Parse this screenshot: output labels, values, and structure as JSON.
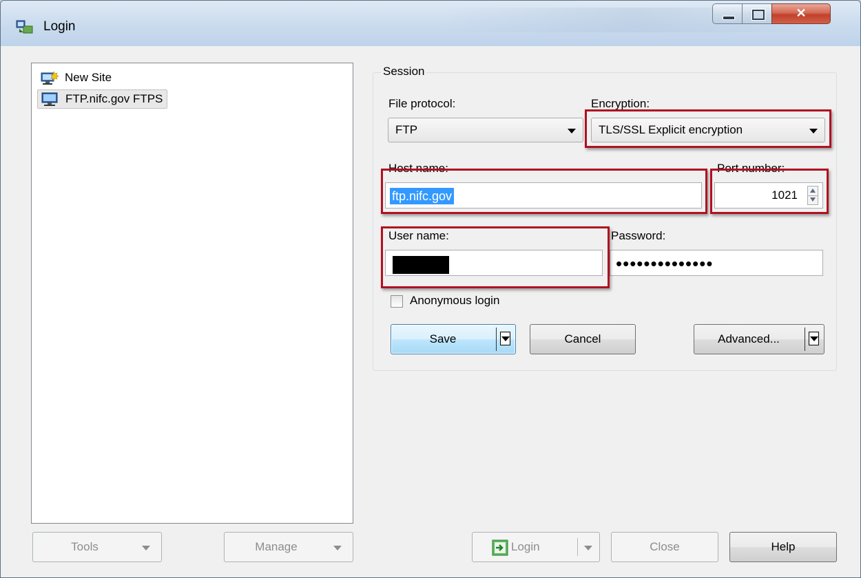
{
  "window": {
    "title": "Login"
  },
  "sites": [
    {
      "label": "New Site",
      "icon": "new-site-icon",
      "selected": false
    },
    {
      "label": "FTP.nifc.gov FTPS",
      "icon": "computer-icon",
      "selected": true
    }
  ],
  "session": {
    "group_title": "Session",
    "file_protocol_label": "File protocol:",
    "file_protocol_value": "FTP",
    "encryption_label": "Encryption:",
    "encryption_value": "TLS/SSL Explicit encryption",
    "host_label": "Host name:",
    "host_value": "ftp.nifc.gov",
    "port_label": "Port number:",
    "port_value": "1021",
    "user_label": "User name:",
    "password_label": "Password:",
    "password_mask": "••••••••••••••",
    "anonymous_label": "Anonymous login",
    "anonymous_checked": false
  },
  "buttons": {
    "save": "Save",
    "cancel": "Cancel",
    "advanced": "Advanced...",
    "tools": "Tools",
    "manage": "Manage",
    "login": "Login",
    "close": "Close",
    "help": "Help"
  },
  "colors": {
    "highlight_red": "#b01020",
    "selection_blue": "#3399ff"
  }
}
